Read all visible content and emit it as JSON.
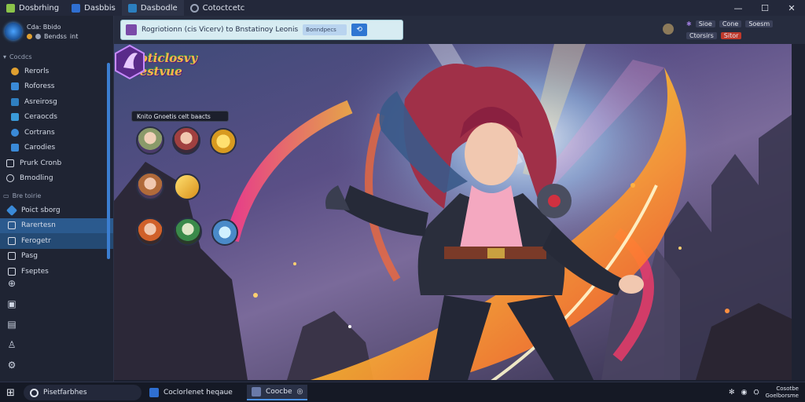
{
  "tabs": [
    {
      "label": "Dosbrhing",
      "color": "#8bc34a"
    },
    {
      "label": "Dasbbis",
      "color": "#2f6fd1"
    },
    {
      "label": "Dasbodle",
      "color": "#2b7fbf"
    },
    {
      "label": "Cotoctcetc",
      "color": "#9aa4b8"
    }
  ],
  "window_controls": {
    "minimize": "—",
    "maximize": "☐",
    "close": "✕"
  },
  "sidebar": {
    "head_line1": "Cda: Bbido",
    "head_line2": "Bendss",
    "head_line2_suffix": "int",
    "section1": "Cocdcs",
    "items": [
      {
        "label": "Rerorls",
        "color": "#e0a030"
      },
      {
        "label": "Roforess",
        "color": "#3a8ad8"
      },
      {
        "label": "Asreirosg",
        "color": "#2f7fc0"
      },
      {
        "label": "Ceraocds",
        "color": "#3a9ad8"
      },
      {
        "label": "Cortrans",
        "color": "#3a8ad8"
      },
      {
        "label": "Carodies",
        "color": "#3a8ad8"
      },
      {
        "label": "Prurk Cronb",
        "color": "#d8dde8"
      },
      {
        "label": "Bmodling",
        "color": "#d8dde8"
      }
    ],
    "section2": "Bre toirie",
    "items2": [
      {
        "label": "Poict sborg",
        "color": "#3a8ad8",
        "selected": false
      },
      {
        "label": "Rarertesn",
        "color": "#d8dde8",
        "selected": true
      },
      {
        "label": "Ferogetr",
        "color": "#d8dde8",
        "selected": true
      },
      {
        "label": "Pasg",
        "color": "#d8dde8",
        "selected": false
      },
      {
        "label": "Fseptes",
        "color": "#d8dde8",
        "selected": false
      }
    ],
    "bottom_icons": [
      "download-icon",
      "window-icon",
      "archive-icon",
      "user-icon",
      "settings-icon"
    ]
  },
  "address_bar": {
    "text": "Rogriotionn (cis Vicerv) to Bnstatinoy Leonis",
    "field": "Bonndpecs",
    "button": "⟲"
  },
  "toolbar_right": {
    "row1": [
      "Sioe",
      "Cone",
      "Soesm"
    ],
    "row2": [
      "Ctorsirs",
      "Sitor"
    ]
  },
  "game": {
    "logo_line1": "Goticlosvy",
    "logo_line2": "Bestvue",
    "char_header": "Knito Gnoetis celt baacts"
  },
  "taskbar": {
    "search_label": "Pisetfarbhes",
    "app1": "Coclorlenet heqaue",
    "app2": "Coocbe",
    "clock_line1": "Cosotbe",
    "clock_line2": "Goelborsme"
  }
}
